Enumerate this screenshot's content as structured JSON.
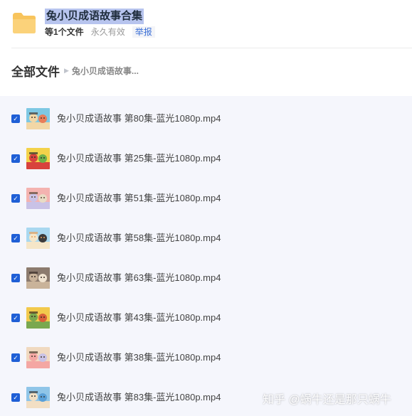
{
  "header": {
    "title": "兔小贝成语故事合集",
    "file_count": "等1个文件",
    "validity": "永久有效",
    "report": "举报",
    "folder_icon": "folder-icon",
    "folder_color": "#f8c45c"
  },
  "breadcrumb": {
    "root": "全部文件",
    "current": "兔小贝成语故事..."
  },
  "files": [
    {
      "name": "兔小贝成语故事 第80集-蓝光1080p.mp4",
      "checked": true
    },
    {
      "name": "兔小贝成语故事 第25集-蓝光1080p.mp4",
      "checked": true
    },
    {
      "name": "兔小贝成语故事 第51集-蓝光1080p.mp4",
      "checked": true
    },
    {
      "name": "兔小贝成语故事 第58集-蓝光1080p.mp4",
      "checked": true
    },
    {
      "name": "兔小贝成语故事 第63集-蓝光1080p.mp4",
      "checked": true
    },
    {
      "name": "兔小贝成语故事 第43集-蓝光1080p.mp4",
      "checked": true
    },
    {
      "name": "兔小贝成语故事 第38集-蓝光1080p.mp4",
      "checked": true
    },
    {
      "name": "兔小贝成语故事 第83集-蓝光1080p.mp4",
      "checked": true
    }
  ],
  "watermark": "知乎 @蜗牛还是那只蜗牛",
  "colors": {
    "accent": "#1f5fd6",
    "list_bg": "#f5f6fc",
    "highlight": "#b7c4ee"
  }
}
